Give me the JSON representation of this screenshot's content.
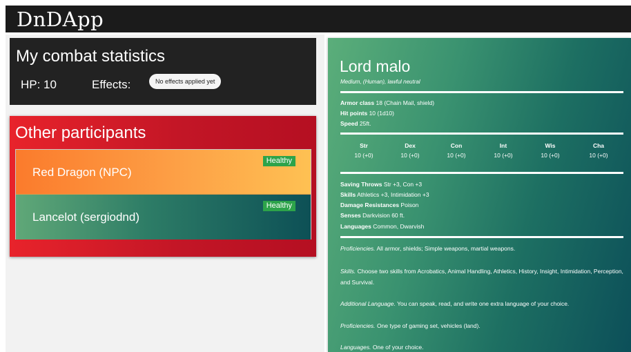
{
  "app": {
    "title": "DnDApp"
  },
  "combat": {
    "title": "My combat statistics",
    "hp": "HP: 10",
    "effects_label": "Effects:",
    "effects_badge": "No effects applied yet"
  },
  "participants": {
    "title": "Other participants",
    "items": [
      {
        "name": "Red Dragon (NPC)",
        "status": "Healthy"
      },
      {
        "name": "Lancelot (sergiodnd)",
        "status": "Healthy"
      }
    ]
  },
  "sheet": {
    "name": "Lord malo",
    "subtitle": "Medium, (Human), lawful neutral",
    "armor_class": {
      "label": "Armor class",
      "value": "18 (Chain Mail, shield)"
    },
    "hit_points": {
      "label": "Hit points",
      "value": "10 (1d10)"
    },
    "speed": {
      "label": "Speed",
      "value": "25ft."
    },
    "abilities": [
      {
        "abbr": "Str",
        "score": "10 (+0)"
      },
      {
        "abbr": "Dex",
        "score": "10 (+0)"
      },
      {
        "abbr": "Con",
        "score": "10 (+0)"
      },
      {
        "abbr": "Int",
        "score": "10 (+0)"
      },
      {
        "abbr": "Wis",
        "score": "10 (+0)"
      },
      {
        "abbr": "Cha",
        "score": "10 (+0)"
      }
    ],
    "saving_throws": {
      "label": "Saving Throws",
      "value": "Str +3, Con +3"
    },
    "skills": {
      "label": "Skills",
      "value": "Athletics +3, Intimidation +3"
    },
    "damage_resistances": {
      "label": "Damage Resistances",
      "value": "Poison"
    },
    "senses": {
      "label": "Senses",
      "value": "Darkvision 60 ft."
    },
    "languages": {
      "label": "Languages",
      "value": "Common, Dwarvish"
    },
    "traits": [
      {
        "title": "Proficiencies.",
        "text": "All armor, shields; Simple weapons, martial weapons."
      },
      {
        "title": "Skills.",
        "text": "Choose two skills from Acrobatics, Animal Handling, Athletics, History, Insight, Intimidation, Perception, and Survival."
      },
      {
        "title": "Additional Language.",
        "text": "You can speak, read, and write one extra language of your choice."
      },
      {
        "title": "Proficiencies.",
        "text": "One type of gaming set, vehicles (land)."
      },
      {
        "title": "Languages.",
        "text": "One of your choice."
      }
    ]
  },
  "colors": {
    "topbar": "#1b1b1b",
    "participants_panel": "#c31626",
    "status_healthy": "#2da34a",
    "sheet_gradient_start": "#5bae7a",
    "sheet_gradient_end": "#0c4f59"
  }
}
